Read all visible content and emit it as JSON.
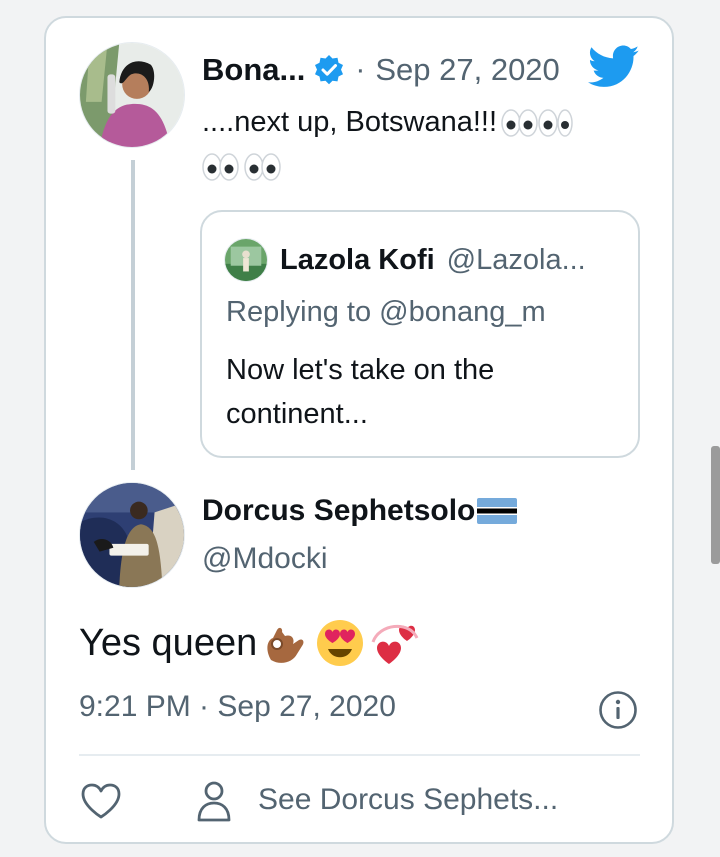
{
  "parent_tweet": {
    "author_name": "Bona...",
    "separator": "·",
    "date": "Sep 27, 2020",
    "text": "....next up, Botswana!!!",
    "avatar_icon": "person-avatar",
    "verified_icon": "verified-badge-icon",
    "platform_icon": "twitter-bird-icon"
  },
  "quoted_tweet": {
    "author_name": "Lazola Kofi",
    "handle": "@Lazola...",
    "replying_to": "Replying to @bonang_m",
    "text": "Now let's take on the continent..."
  },
  "main_tweet": {
    "author_name": "Dorcus Sephetsolo",
    "handle": "@Mdocki",
    "text": "Yes queen",
    "timestamp": "9:21 PM · Sep 27, 2020",
    "see_more_label": "See Dorcus Sephets..."
  },
  "colors": {
    "twitter_blue": "#1d9bf0",
    "secondary_text": "#536471",
    "border": "#cfd9de"
  }
}
